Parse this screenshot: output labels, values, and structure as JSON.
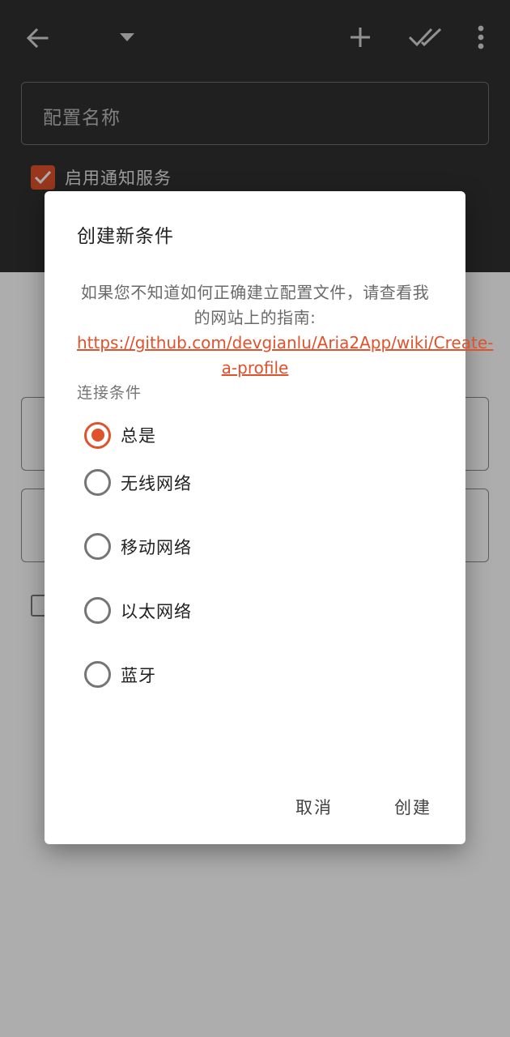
{
  "toolbar": {
    "back_icon": "arrow-left-icon",
    "dropdown_icon": "caret-down-icon",
    "add_icon": "plus-icon",
    "done_all_icon": "double-check-icon",
    "more_icon": "more-vertical-icon"
  },
  "form": {
    "profile_name_placeholder": "配置名称",
    "enable_notifications_label": "启用通知服务",
    "enable_notifications_checked": true
  },
  "dialog": {
    "title": "创建新条件",
    "message_text": "如果您不知道如何正确建立配置文件，请查看我的网站上的指南: ",
    "message_link": "https://github.com/devgianlu/Aria2App/wiki/Create-a-profile",
    "section_label": "连接条件",
    "options": [
      {
        "label": "总是",
        "checked": true
      },
      {
        "label": "无线网络",
        "checked": false
      },
      {
        "label": "移动网络",
        "checked": false
      },
      {
        "label": "以太网络",
        "checked": false
      },
      {
        "label": "蓝牙",
        "checked": false
      }
    ],
    "cancel_label": "取消",
    "create_label": "创建"
  },
  "colors": {
    "accent": "#e0522b",
    "toolbar_bg": "#303030",
    "scrim": "rgba(0,0,0,0.32)"
  }
}
